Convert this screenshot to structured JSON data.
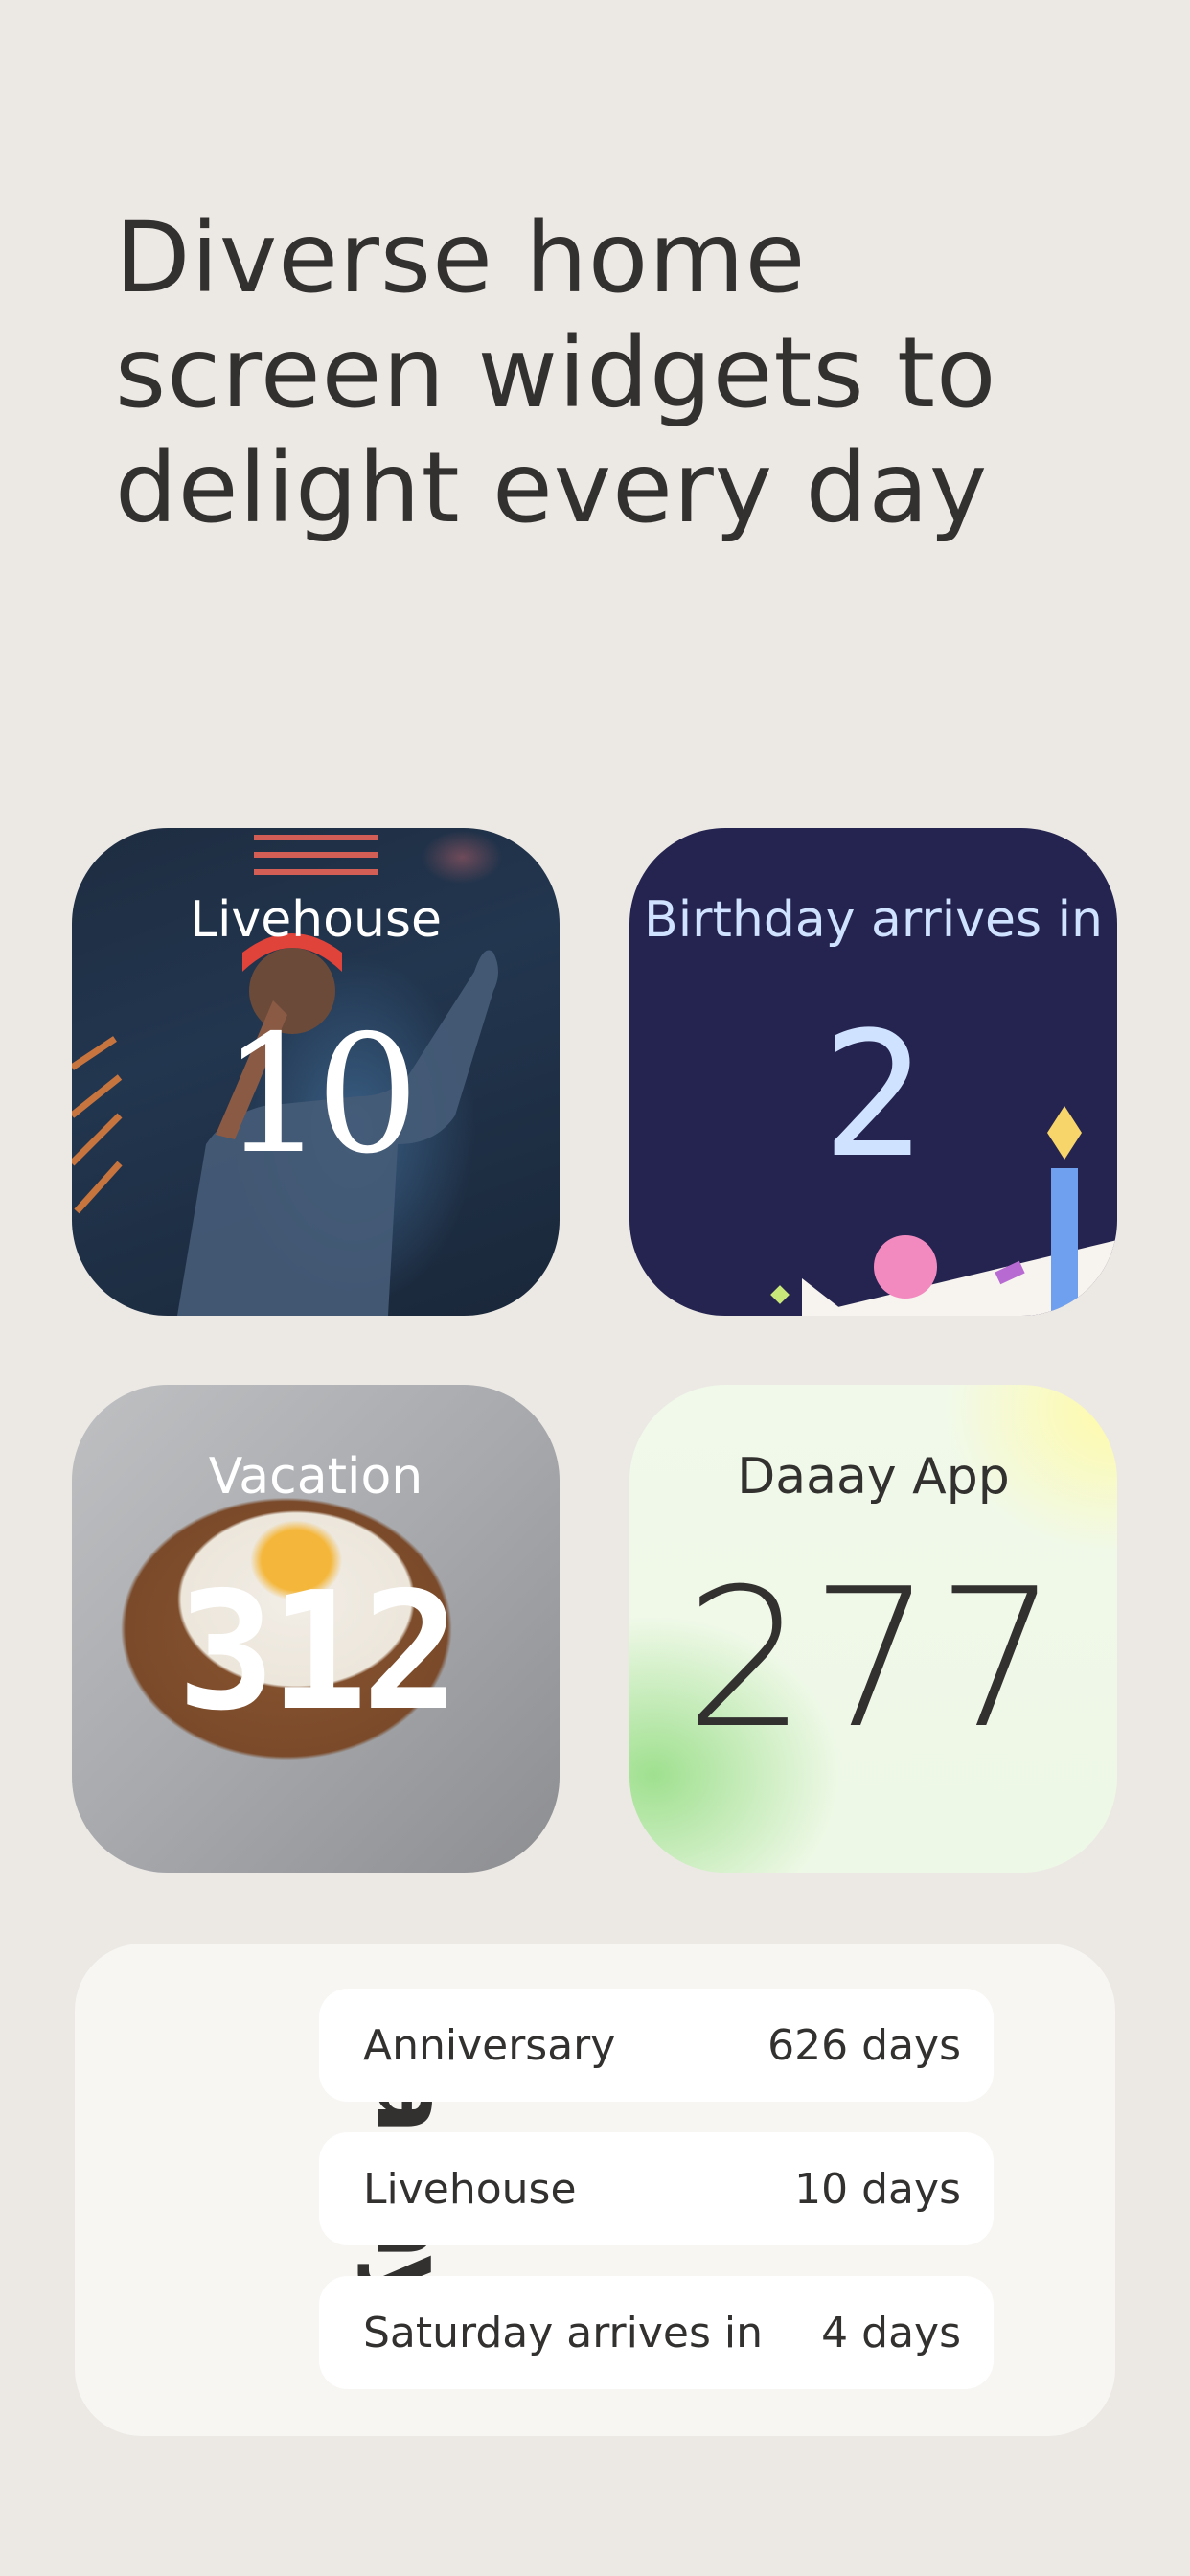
{
  "headline": {
    "line1": "Diverse home",
    "line2": "screen widgets to",
    "line3": "delight every day"
  },
  "widgets": {
    "livehouse": {
      "title": "Livehouse",
      "value": "10"
    },
    "birthday": {
      "title": "Birthday arrives in",
      "value": "2"
    },
    "vacation": {
      "title": "Vacation",
      "value": "312"
    },
    "daaay_app": {
      "title": "Daaay App",
      "value": "277"
    }
  },
  "list_widget": {
    "brand": "Daaay",
    "rows": [
      {
        "label": "Anniversary",
        "value": "626 days"
      },
      {
        "label": "Livehouse",
        "value": "10 days"
      },
      {
        "label": "Saturday arrives in",
        "value": "4 days"
      }
    ]
  },
  "colors": {
    "background": "#ece9e5",
    "text_dark": "#333130",
    "birthday_bg": "#252450",
    "birthday_text": "#cfe2ff"
  }
}
